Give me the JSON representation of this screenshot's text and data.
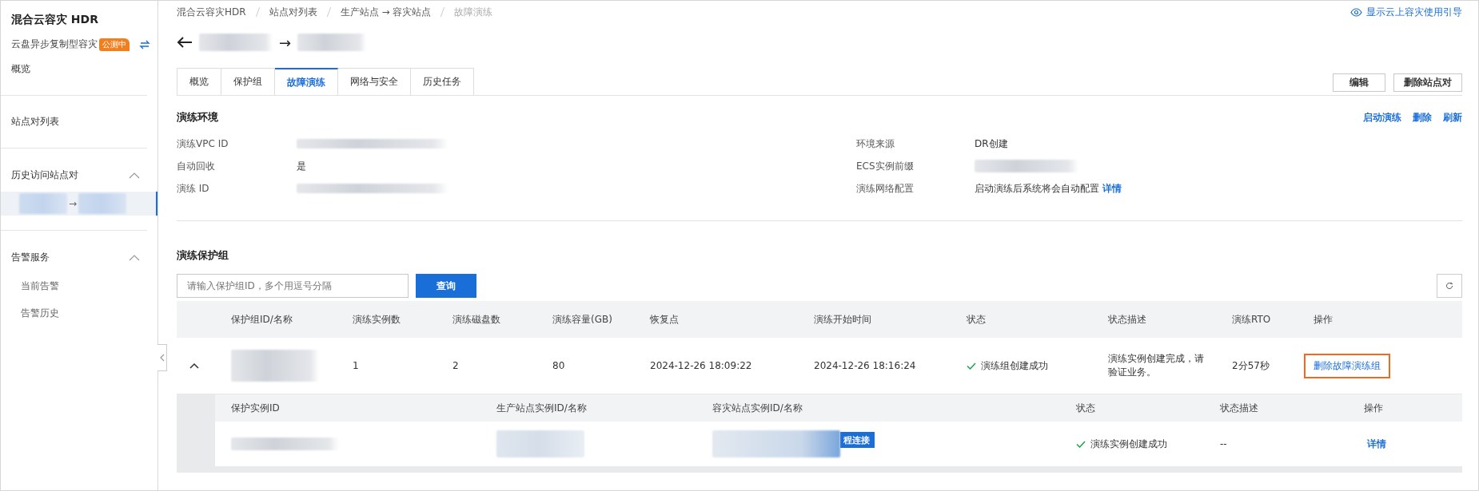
{
  "sidebar": {
    "title": "混合云容灾 HDR",
    "subtitle": "云盘异步复制型容灾",
    "badge": "公测中",
    "overview": "概览",
    "sections": [
      {
        "kind": "link",
        "label": "站点对列表"
      },
      {
        "kind": "group",
        "label": "历史访问站点对",
        "expanded": true,
        "children": [
          {
            "label": "→",
            "selected": true,
            "redacted": true
          }
        ]
      },
      {
        "kind": "group",
        "label": "告警服务",
        "expanded": true,
        "children": [
          {
            "label": "当前告警",
            "selected": false,
            "redacted": false
          },
          {
            "label": "告警历史",
            "selected": false,
            "redacted": false
          }
        ]
      }
    ]
  },
  "breadcrumb": [
    {
      "label": "混合云容灾HDR",
      "current": false
    },
    {
      "label": "生产站点 → 容灾站点",
      "current": false
    },
    {
      "label": "故障演练",
      "current": true
    }
  ],
  "breadcrumb_second": "站点对列表",
  "guide_link": "显示云上容灾使用引导",
  "page_title": {
    "separator": "→",
    "redacted": true
  },
  "tabs": [
    {
      "label": "概览",
      "selected": false
    },
    {
      "label": "保护组",
      "selected": false
    },
    {
      "label": "故障演练",
      "selected": true
    },
    {
      "label": "网络与安全",
      "selected": false
    },
    {
      "label": "历史任务",
      "selected": false
    }
  ],
  "header_buttons": [
    "编辑",
    "删除站点对"
  ],
  "environment": {
    "title": "演练环境",
    "actions": [
      "启动演练",
      "删除",
      "刷新"
    ],
    "left": [
      {
        "label": "演练VPC ID",
        "redacted": true
      },
      {
        "label": "自动回收",
        "value": "是"
      },
      {
        "label": "演练 ID",
        "redacted": true
      }
    ],
    "right": [
      {
        "label": "环境来源",
        "value": "DR创建"
      },
      {
        "label": "ECS实例前缀",
        "redacted": true
      },
      {
        "label": "演练网络配置",
        "value": "启动演练后系统将会自动配置",
        "link": "详情"
      }
    ]
  },
  "groups": {
    "title": "演练保护组",
    "search": {
      "placeholder": "请输入保护组ID，多个用逗号分隔"
    },
    "query_button": "查询",
    "columns": [
      "保护组ID/名称",
      "演练实例数",
      "演练磁盘数",
      "演练容量(GB)",
      "恢复点",
      "演练开始时间",
      "状态",
      "状态描述",
      "演练RTO",
      "操作"
    ],
    "rows": [
      {
        "expanded": true,
        "id_redacted": true,
        "instances": "1",
        "disks": "2",
        "capacity": "80",
        "recovery_point": "2024-12-26 18:09:22",
        "start_time": "2024-12-26 18:16:24",
        "status": "演练组创建成功",
        "status_ok": true,
        "description": "演练实例创建完成，请验证业务。",
        "rto": "2分57秒",
        "action": "删除故障演练组",
        "action_highlighted": true,
        "sub_columns": [
          "保护实例ID",
          "生产站点实例ID/名称",
          "容灾站点实例ID/名称",
          "状态",
          "状态描述",
          "操作"
        ],
        "sub_rows": [
          {
            "connect_button": "程连接",
            "status": "演练实例创建成功",
            "status_ok": true,
            "description": "--",
            "action": "详情"
          }
        ]
      }
    ]
  }
}
